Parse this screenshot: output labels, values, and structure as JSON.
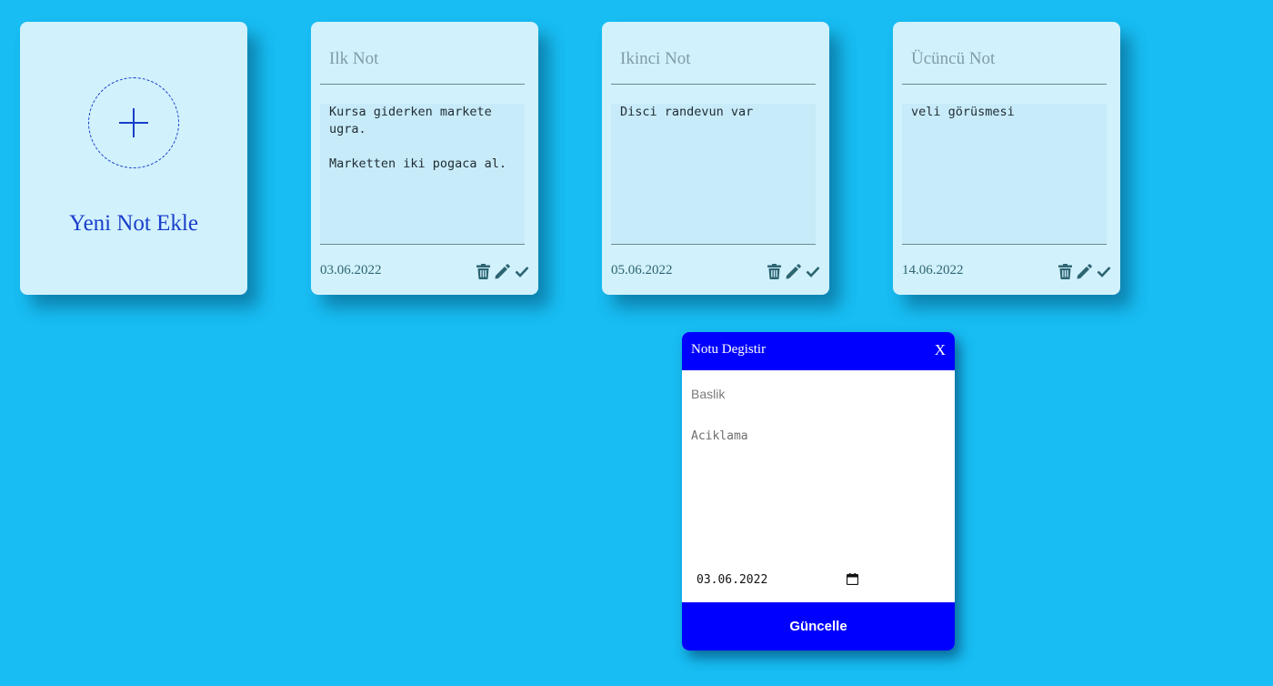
{
  "add_card": {
    "label": "Yeni Not Ekle",
    "icon": "plus-icon"
  },
  "notes": [
    {
      "title": "Ilk Not",
      "body": "Kursa giderken markete ugra.\n\nMarketten iki pogaca al.",
      "date": "03.06.2022"
    },
    {
      "title": "Ikinci Not",
      "body": "Disci randevun var",
      "date": "05.06.2022"
    },
    {
      "title": "Ücüncü Not",
      "body": "veli görüsmesi",
      "date": "14.06.2022"
    }
  ],
  "note_actions": [
    "trash-icon",
    "pencil-icon",
    "check-icon"
  ],
  "modal": {
    "title": "Notu Degistir",
    "close_label": "X",
    "title_placeholder": "Baslik",
    "description_placeholder": "Aciklama",
    "date_value": "03.06.2022",
    "submit_label": "Güncelle"
  },
  "colors": {
    "background": "#17bdf3",
    "card": "#d1f1fd",
    "accent": "#0000ff",
    "icon": "#2d6571",
    "add_accent": "#1a3fc9"
  }
}
